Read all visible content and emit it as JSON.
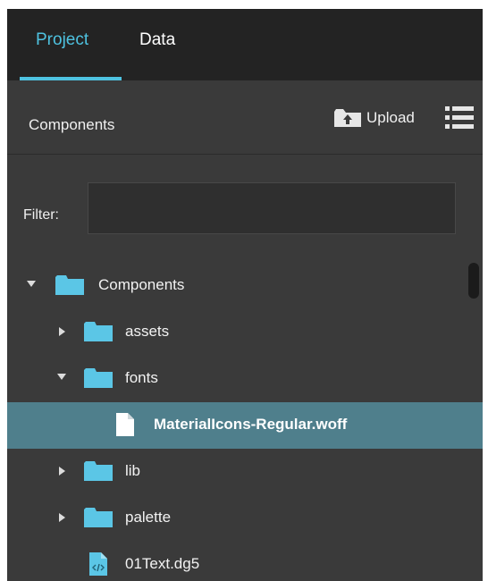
{
  "tabs": [
    {
      "label": "Project",
      "active": true
    },
    {
      "label": "Data",
      "active": false
    }
  ],
  "header": {
    "title": "Components",
    "upload_label": "Upload"
  },
  "filter": {
    "label": "Filter:",
    "value": "",
    "placeholder": ""
  },
  "tree": [
    {
      "label": "Components",
      "type": "folder",
      "state": "expanded"
    },
    {
      "label": "assets",
      "type": "folder",
      "state": "collapsed"
    },
    {
      "label": "fonts",
      "type": "folder",
      "state": "expanded"
    },
    {
      "label": "MaterialIcons-Regular.woff",
      "type": "file",
      "selected": true
    },
    {
      "label": "lib",
      "type": "folder",
      "state": "collapsed"
    },
    {
      "label": "palette",
      "type": "folder",
      "state": "collapsed"
    },
    {
      "label": "01Text.dg5",
      "type": "code-file"
    }
  ],
  "colors": {
    "accent": "#4ec2e0",
    "panel_bg": "#3a3a3a",
    "header_bg": "#232323",
    "selected_row": "#4f7f8c",
    "folder": "#5bc6e6"
  }
}
